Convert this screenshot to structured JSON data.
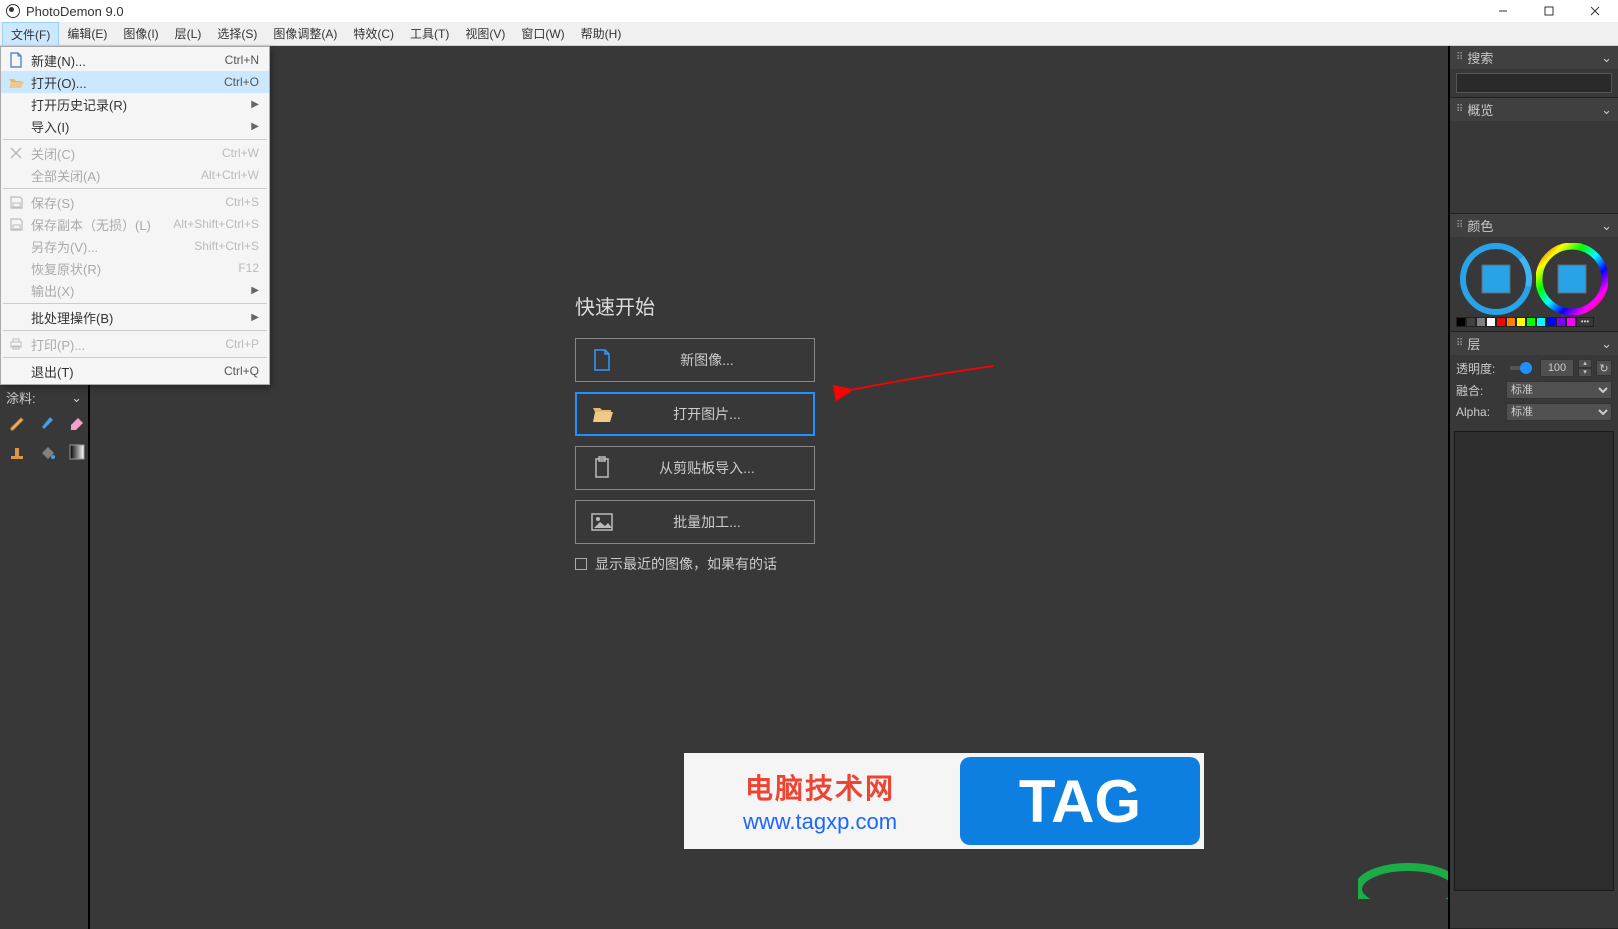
{
  "title": "PhotoDemon 9.0",
  "menubar": [
    "文件(F)",
    "编辑(E)",
    "图像(I)",
    "层(L)",
    "选择(S)",
    "图像调整(A)",
    "特效(C)",
    "工具(T)",
    "视图(V)",
    "窗口(W)",
    "帮助(H)"
  ],
  "file_menu": {
    "items": [
      {
        "label": "新建(N)...",
        "shortcut": "Ctrl+N",
        "icon": "new",
        "enabled": true,
        "hover": false
      },
      {
        "label": "打开(O)...",
        "shortcut": "Ctrl+O",
        "icon": "open",
        "enabled": true,
        "hover": true
      },
      {
        "label": "打开历史记录(R)",
        "shortcut": "",
        "icon": "",
        "enabled": true,
        "hover": false,
        "submenu": true
      },
      {
        "label": "导入(I)",
        "shortcut": "",
        "icon": "",
        "enabled": true,
        "hover": false,
        "submenu": true
      },
      {
        "sep": true
      },
      {
        "label": "关闭(C)",
        "shortcut": "Ctrl+W",
        "icon": "close",
        "enabled": false,
        "hover": false
      },
      {
        "label": "全部关闭(A)",
        "shortcut": "Alt+Ctrl+W",
        "icon": "",
        "enabled": false,
        "hover": false
      },
      {
        "sep": true
      },
      {
        "label": "保存(S)",
        "shortcut": "Ctrl+S",
        "icon": "save",
        "enabled": false,
        "hover": false
      },
      {
        "label": "保存副本（无损）(L)",
        "shortcut": "Alt+Shift+Ctrl+S",
        "icon": "savecopy",
        "enabled": false,
        "hover": false
      },
      {
        "label": "另存为(V)...",
        "shortcut": "Shift+Ctrl+S",
        "icon": "",
        "enabled": false,
        "hover": false
      },
      {
        "label": "恢复原状(R)",
        "shortcut": "F12",
        "icon": "",
        "enabled": false,
        "hover": false
      },
      {
        "label": "输出(X)",
        "shortcut": "",
        "icon": "",
        "enabled": false,
        "hover": false,
        "submenu": true
      },
      {
        "sep": true
      },
      {
        "label": "批处理操作(B)",
        "shortcut": "",
        "icon": "",
        "enabled": true,
        "hover": false,
        "submenu": true
      },
      {
        "sep": true
      },
      {
        "label": "打印(P)...",
        "shortcut": "Ctrl+P",
        "icon": "print",
        "enabled": false,
        "hover": false
      },
      {
        "sep": true
      },
      {
        "label": "退出(T)",
        "shortcut": "Ctrl+Q",
        "icon": "",
        "enabled": true,
        "hover": false
      }
    ]
  },
  "left": {
    "coating_label": "涂料:"
  },
  "quick": {
    "title": "快速开始",
    "btn_new": "新图像...",
    "btn_open": "打开图片...",
    "btn_clip": "从剪贴板导入...",
    "btn_batch": "批量加工...",
    "chk": "显示最近的图像，如果有的话"
  },
  "right": {
    "search": "搜索",
    "preview": "概览",
    "color": "颜色",
    "layers": "层",
    "opacity_label": "透明度:",
    "opacity_value": "100",
    "blend_label": "融合:",
    "blend_value": "标准",
    "alpha_label": "Alpha:",
    "alpha_value": "标准"
  },
  "swatches": [
    "#000000",
    "#404040",
    "#808080",
    "#ffffff",
    "#ff0000",
    "#ff8000",
    "#ffff00",
    "#00ff00",
    "#00ffff",
    "#0000ff",
    "#8000ff",
    "#ff00ff"
  ],
  "watermark": {
    "line1": "电脑技术网",
    "line2": "www.tagxp.com",
    "tag": "TAG"
  }
}
